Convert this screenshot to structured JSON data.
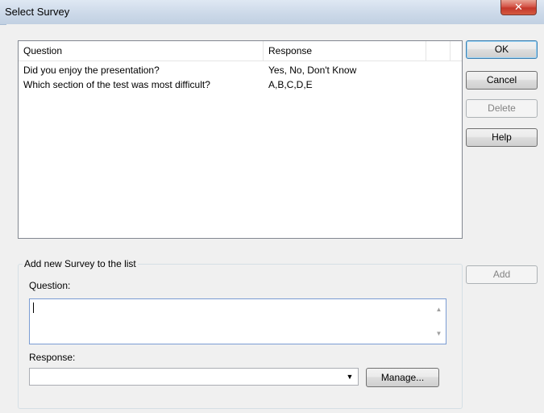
{
  "window": {
    "title": "Select Survey",
    "close_glyph": "✕"
  },
  "list": {
    "columns": [
      "Question",
      "Response"
    ],
    "rows": [
      {
        "question": "Did you enjoy the presentation?",
        "response": "Yes, No, Don't Know"
      },
      {
        "question": "Which section of the test was most difficult?",
        "response": "A,B,C,D,E"
      }
    ]
  },
  "buttons": {
    "ok": "OK",
    "cancel": "Cancel",
    "delete": "Delete",
    "help": "Help",
    "add": "Add",
    "manage": "Manage..."
  },
  "add_group": {
    "label": "Add new Survey to the list",
    "question_label": "Question:",
    "question_value": "",
    "response_label": "Response:",
    "response_value": ""
  },
  "icons": {
    "close": "close-icon",
    "scroll_up": "scroll-up-arrow-icon",
    "scroll_down": "scroll-down-arrow-icon",
    "dropdown": "chevron-down-icon"
  }
}
